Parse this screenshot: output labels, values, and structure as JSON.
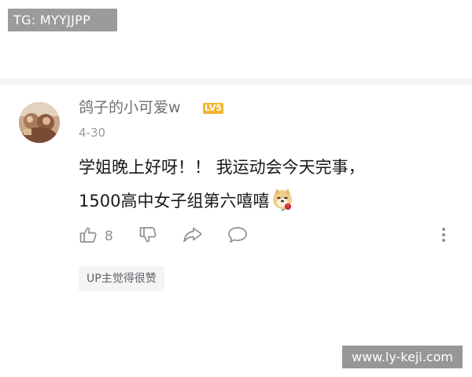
{
  "watermark_top": "TG: MYYJJPP",
  "watermark_bottom": "www.ly-keji.com",
  "comment": {
    "username": "鸽子的小可爱w",
    "level": "LV5",
    "date": "4-30",
    "text_line1": "学姐晚上好呀！！ 我运动会今天完事，",
    "text_line2": "1500高中女子组第六嘻嘻",
    "emoji": "doge-rose-emoji",
    "like_count": "8",
    "up_liked_tag": "UP主觉得很赞"
  },
  "icons": {
    "like": "thumbs-up-icon",
    "dislike": "thumbs-down-icon",
    "share": "share-arrow-icon",
    "reply": "speech-bubble-icon",
    "more": "vertical-dots-icon"
  },
  "colors": {
    "level_badge": "#f0b432",
    "username": "#6f6f76",
    "icon_gray": "#8f9095",
    "text": "#18191c",
    "tag_bg": "#f4f4f5"
  }
}
